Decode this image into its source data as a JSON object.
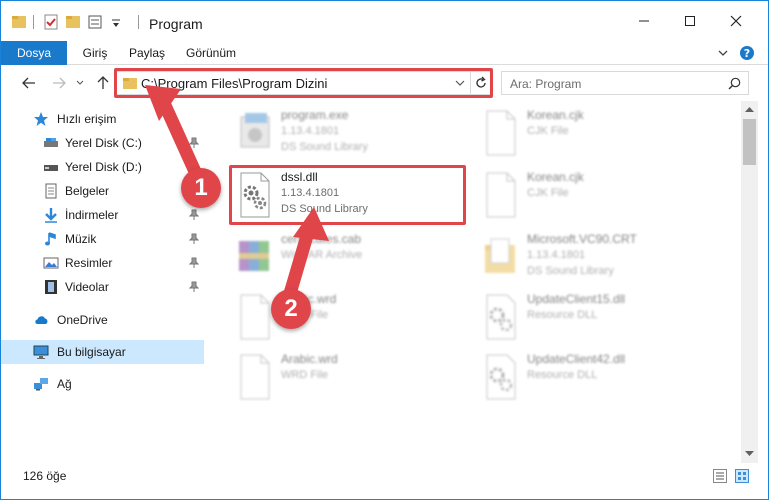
{
  "window": {
    "title": "Program"
  },
  "ribbon": {
    "tabs": [
      {
        "label": "Dosya"
      },
      {
        "label": "Giriş"
      },
      {
        "label": "Paylaş"
      },
      {
        "label": "Görünüm"
      }
    ]
  },
  "address": {
    "path": "C:\\Program Files\\Program Dizini"
  },
  "search": {
    "placeholder": "Ara: Program"
  },
  "sidebar": {
    "items": [
      {
        "label": "Hızlı erişim",
        "icon": "star-icon"
      },
      {
        "label": "Yerel Disk (C:)",
        "icon": "drive-icon"
      },
      {
        "label": "Yerel Disk (D:)",
        "icon": "drive-icon"
      },
      {
        "label": "Belgeler",
        "icon": "documents-icon"
      },
      {
        "label": "İndirmeler",
        "icon": "download-icon"
      },
      {
        "label": "Müzik",
        "icon": "music-icon"
      },
      {
        "label": "Resimler",
        "icon": "pictures-icon"
      },
      {
        "label": "Videolar",
        "icon": "video-icon"
      },
      {
        "label": "OneDrive",
        "icon": "cloud-icon"
      },
      {
        "label": "Bu bilgisayar",
        "icon": "computer-icon"
      },
      {
        "label": "Ağ",
        "icon": "network-icon"
      }
    ]
  },
  "files": [
    {
      "name": "program.exe",
      "sub1": "1.13.4.1801",
      "sub2": "DS Sound Library",
      "icon": "exe-icon"
    },
    {
      "name": "Korean.cjk",
      "sub1": "CJK File",
      "sub2": "",
      "icon": "blank-file-icon"
    },
    {
      "name": "dssl.dll",
      "sub1": "1.13.4.1801",
      "sub2": "DS Sound Library",
      "icon": "dll-gear-icon"
    },
    {
      "name": "Korean.cjk",
      "sub1": "CJK File",
      "sub2": "",
      "icon": "blank-file-icon"
    },
    {
      "name": "certificates.cab",
      "sub1": "WinRAR Archive",
      "sub2": "",
      "icon": "winrar-icon"
    },
    {
      "name": "Microsoft.VC90.CRT",
      "sub1": "1.13.4.1801",
      "sub2": "DS Sound Library",
      "icon": "folder-icon"
    },
    {
      "name": "arabic.wrd",
      "sub1": "WRD File",
      "sub2": "",
      "icon": "blank-file-icon"
    },
    {
      "name": "UpdateClient15.dll",
      "sub1": "Resource DLL",
      "sub2": "",
      "icon": "dll-gear-icon"
    },
    {
      "name": "Arabic.wrd",
      "sub1": "WRD File",
      "sub2": "",
      "icon": "blank-file-icon"
    },
    {
      "name": "UpdateClient42.dll",
      "sub1": "Resource DLL",
      "sub2": "",
      "icon": "dll-gear-icon"
    }
  ],
  "status": {
    "count": "126 öğe"
  },
  "callouts": {
    "one": "1",
    "two": "2"
  },
  "colors": {
    "accent": "#1979ca",
    "highlight": "#e0454a",
    "selected": "#cce8ff"
  }
}
